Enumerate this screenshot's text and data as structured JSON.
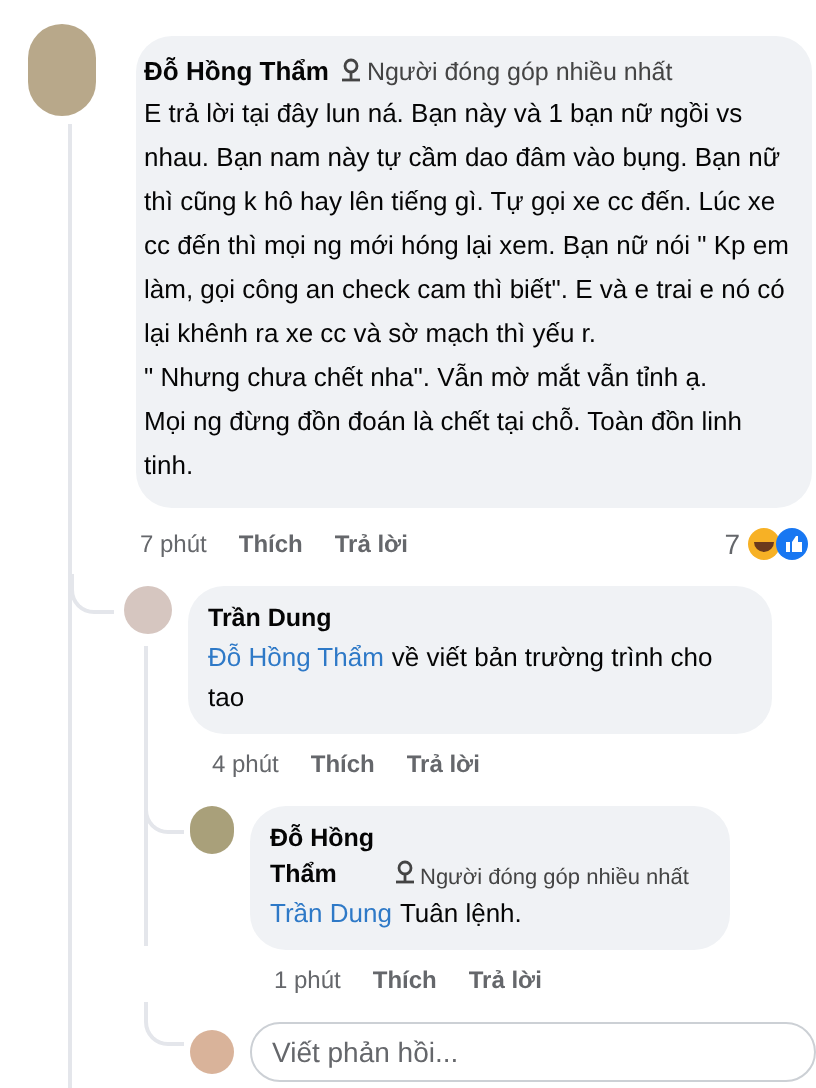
{
  "comment": {
    "author": "Đỗ Hồng Thẩm",
    "badge": "Người đóng góp nhiều nhất",
    "text": "E trả lời tại đây lun ná. Bạn này và 1 bạn nữ ngồi vs nhau. Bạn nam này tự cầm dao đâm vào bụng. Bạn nữ thì cũng k hô hay lên tiếng gì. Tự gọi xe cc đến. Lúc xe cc đến thì mọi ng mới hóng lại xem. Bạn nữ nói \" Kp em làm, gọi công an check cam thì biết\". E và e trai e nó có lại khênh ra xe cc và sờ mạch thì yếu r.\n\" Nhưng chưa chết nha\". Vẫn mờ mắt vẫn tỉnh ạ.\nMọi ng đừng đồn đoán là chết tại chỗ. Toàn đồn linh tinh.",
    "time": "7 phút",
    "actions": [
      "Thích",
      "Trả lời"
    ],
    "reaction_count": "7"
  },
  "replies": [
    {
      "author": "Trần Dung",
      "mention": "Đỗ Hồng Thẩm",
      "text": "về viết bản trường trình cho tao",
      "time": "4 phút",
      "actions": [
        "Thích",
        "Trả lời"
      ]
    },
    {
      "author": "Đỗ Hồng Thẩm",
      "badge": "Người đóng góp nhiều nhất",
      "mention": "Trần Dung",
      "text": "Tuân lệnh.",
      "time": "1 phút",
      "actions": [
        "Thích",
        "Trả lời"
      ]
    }
  ],
  "reply_field": {
    "placeholder": "Viết phản hồi..."
  }
}
